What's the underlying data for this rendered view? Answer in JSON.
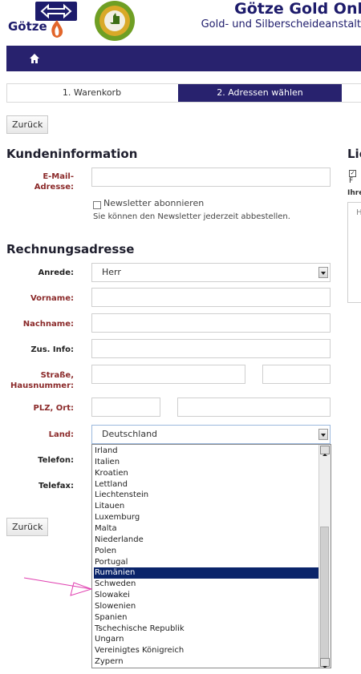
{
  "header": {
    "logo_text": "Götze",
    "seal_text": "KUNDENZUFRIEDENHEIT eKomi",
    "title": "Götze Gold Onl",
    "subtitle": "Gold- und Silberscheideanstalt"
  },
  "steps": [
    "1. Warenkorb",
    "2. Adressen wählen"
  ],
  "buttons": {
    "back_top": "Zurück",
    "back_bottom": "Zurück"
  },
  "customer_info": {
    "heading": "Kundeninformation",
    "email_label": "E-Mail-Adresse:",
    "newsletter_label": "Newsletter abonnieren",
    "newsletter_hint": "Sie können den Newsletter jederzeit abbestellen."
  },
  "billing": {
    "heading": "Rechnungsadresse",
    "salutation_label": "Anrede:",
    "salutation_value": "Herr",
    "firstname_label": "Vorname:",
    "lastname_label": "Nachname:",
    "extra_label": "Zus. Info:",
    "street_label_1": "Straße,",
    "street_label_2": "Hausnummer:",
    "zip_label": "PLZ, Ort:",
    "country_label": "Land:",
    "country_value": "Deutschland",
    "phone_label": "Telefon:",
    "fax_label": "Telefax:"
  },
  "country_list": [
    "Irland",
    "Italien",
    "Kroatien",
    "Lettland",
    "Liechtenstein",
    "Litauen",
    "Luxemburg",
    "Malta",
    "Niederlande",
    "Polen",
    "Portugal",
    "Rumänien",
    "Schweden",
    "Slowakei",
    "Slowenien",
    "Spanien",
    "Tschechische Republik",
    "Ungarn",
    "Vereinigtes Königreich",
    "Zypern"
  ],
  "country_selected": "Rumänien",
  "right_column": {
    "heading": "Lie",
    "checkbox_text": "F",
    "label": "Ihre",
    "box_text": "H"
  },
  "colors": {
    "brand": "#28226e",
    "required_label": "#8b2a2a",
    "selection": "#0a246a"
  }
}
